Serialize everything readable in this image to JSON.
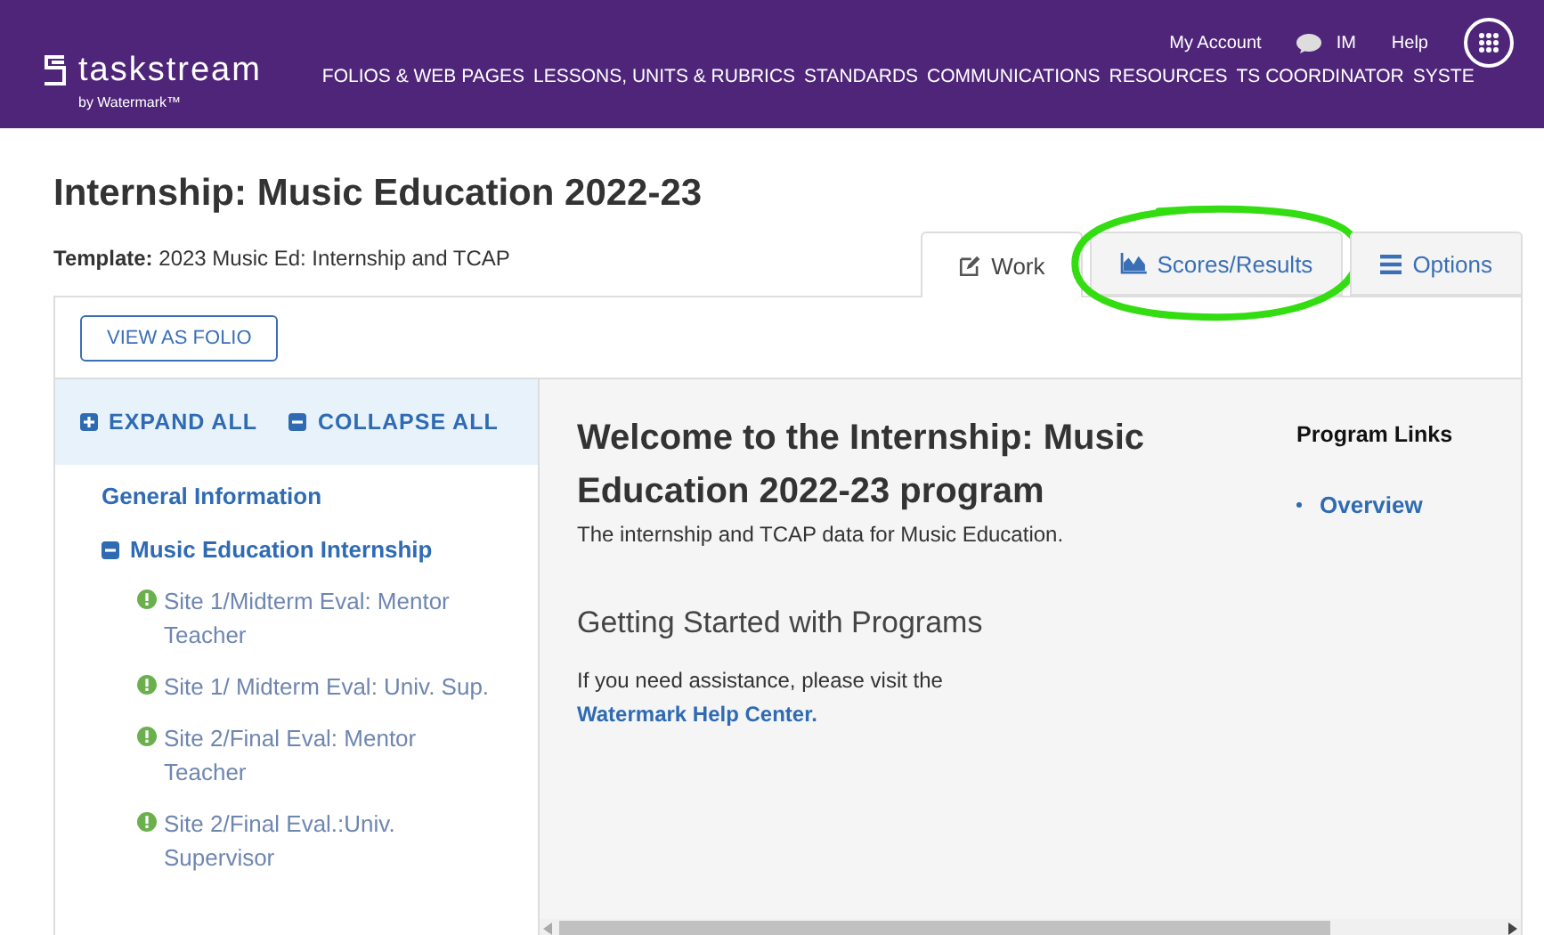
{
  "header": {
    "logo": "taskstream",
    "logo_sub": "by Watermark™",
    "account_links": [
      {
        "kind": "text",
        "label": "My Account"
      },
      {
        "kind": "chat",
        "label": "IM"
      },
      {
        "kind": "text",
        "label": "Help"
      }
    ],
    "nav": [
      "FOLIOS & WEB PAGES",
      "LESSONS, UNITS & RUBRICS",
      "STANDARDS",
      "COMMUNICATIONS",
      "RESOURCES",
      "TS COORDINATOR",
      "SYSTE"
    ]
  },
  "page_title": "Internship: Music Education 2022-23",
  "template": {
    "label": "Template:",
    "value": "2023 Music Ed: Internship and TCAP"
  },
  "tabs": [
    {
      "kind": "work",
      "label": "Work",
      "selected": true,
      "circled": false
    },
    {
      "kind": "scores",
      "label": "Scores/Results",
      "selected": false,
      "circled": true
    },
    {
      "kind": "options",
      "label": "Options",
      "selected": false,
      "circled": false
    }
  ],
  "view_button": "VIEW AS FOLIO",
  "sidebar": {
    "expand_all": "EXPAND ALL",
    "collapse_all": "COLLAPSE ALL",
    "tree": [
      {
        "label": "General Information",
        "expanded": false
      },
      {
        "label": "Music Education Internship",
        "expanded": true,
        "children": [
          {
            "label": "Site 1/Midterm Eval: Mentor Teacher",
            "kind": "alert"
          },
          {
            "label": "Site 1/ Midterm Eval: Univ. Sup.",
            "kind": "alert"
          },
          {
            "label": "Site 2/Final Eval: Mentor Teacher",
            "kind": "alert"
          },
          {
            "label": "Site 2/Final Eval.:Univ. Supervisor",
            "kind": "alert"
          }
        ]
      }
    ]
  },
  "main": {
    "heading": "Welcome to the Internship: Music Education 2022-23 program",
    "description": "The internship and TCAP data for Music Education.",
    "subheading": "Getting Started with Programs",
    "help_text": "If you need assistance, please visit the",
    "help_link": "Watermark Help Center."
  },
  "program_links": {
    "title": "Program Links",
    "links": [
      "Overview"
    ]
  },
  "annotation": {
    "kind": "circle",
    "color": "#33dd11"
  }
}
